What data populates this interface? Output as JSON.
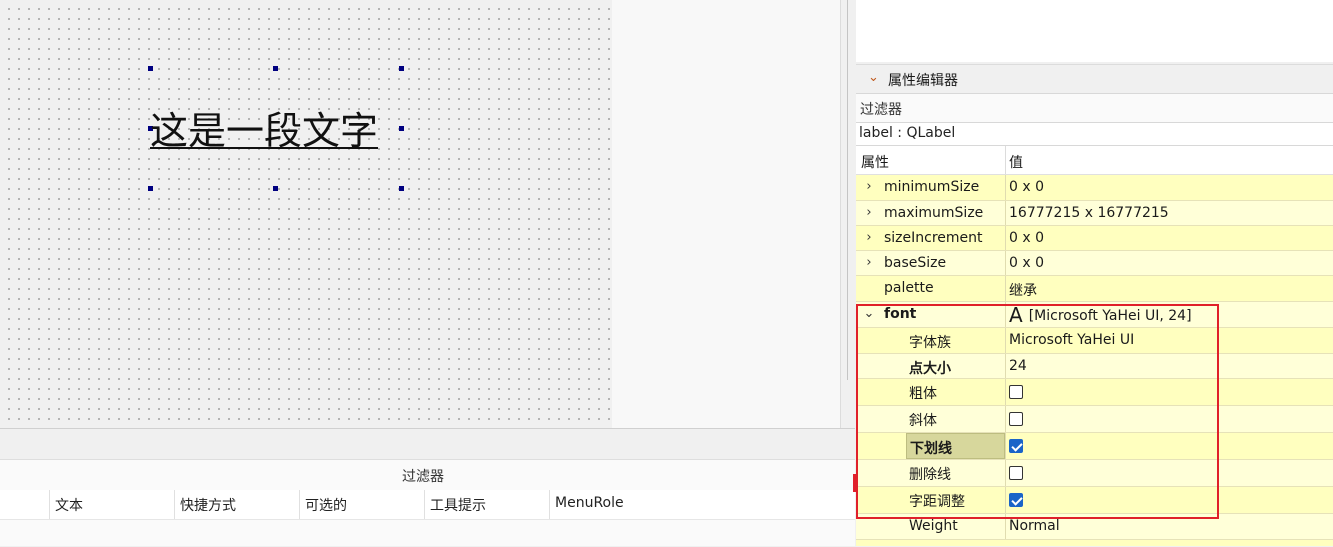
{
  "canvas": {
    "label_text": "这是一段文字"
  },
  "bottom_panel": {
    "filter_label": "过滤器",
    "columns": [
      "文本",
      "快捷方式",
      "可选的",
      "工具提示",
      "MenuRole"
    ]
  },
  "property_editor": {
    "title": "属性编辑器",
    "filter_label": "过滤器",
    "object": "label : QLabel",
    "header": {
      "property": "属性",
      "value": "值"
    },
    "rows": [
      {
        "name": "minimumSize",
        "value": "0 x 0",
        "expandable": true
      },
      {
        "name": "maximumSize",
        "value": "16777215 x 16777215",
        "expandable": true
      },
      {
        "name": "sizeIncrement",
        "value": "0 x 0",
        "expandable": true
      },
      {
        "name": "baseSize",
        "value": "0 x 0",
        "expandable": true
      },
      {
        "name": "palette",
        "value": "继承",
        "expandable": false
      },
      {
        "name": "font",
        "value": "[Microsoft YaHei UI, 24]",
        "icon": "font-A-icon",
        "expanded": true
      },
      {
        "name": "字体族",
        "value": "Microsoft YaHei UI"
      },
      {
        "name": "点大小",
        "value": "24"
      },
      {
        "name": "粗体",
        "checked": false
      },
      {
        "name": "斜体",
        "checked": false
      },
      {
        "name": "下划线",
        "checked": true
      },
      {
        "name": "删除线",
        "checked": false
      },
      {
        "name": "字距调整",
        "checked": true
      },
      {
        "name": "Weight",
        "value": "Normal"
      }
    ]
  },
  "colors": {
    "row_a": "#ffffbf",
    "row_b": "#ffffd8",
    "highlight_box": "#e0202a",
    "check_on": "#1a64c8"
  }
}
